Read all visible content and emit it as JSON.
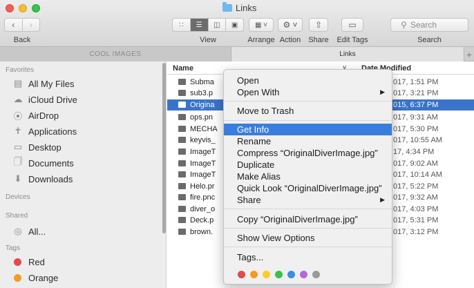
{
  "window": {
    "title": "Links"
  },
  "toolbar": {
    "back_label": "Back",
    "view_label": "View",
    "arrange_label": "Arrange",
    "action_label": "Action",
    "share_label": "Share",
    "edit_tags_label": "Edit Tags",
    "search_label": "Search",
    "search_placeholder": "Search"
  },
  "tabs": [
    {
      "label": "COOL IMAGES",
      "active": false
    },
    {
      "label": "Links",
      "active": true
    }
  ],
  "sidebar": {
    "favorites_header": "Favorites",
    "favorites": [
      {
        "label": "All My Files",
        "icon": "all-files-icon"
      },
      {
        "label": "iCloud Drive",
        "icon": "cloud-icon"
      },
      {
        "label": "AirDrop",
        "icon": "airdrop-icon"
      },
      {
        "label": "Applications",
        "icon": "applications-icon"
      },
      {
        "label": "Desktop",
        "icon": "desktop-icon"
      },
      {
        "label": "Documents",
        "icon": "documents-icon"
      },
      {
        "label": "Downloads",
        "icon": "downloads-icon"
      }
    ],
    "devices_header": "Devices",
    "shared_header": "Shared",
    "shared": [
      {
        "label": "All...",
        "icon": "network-icon"
      }
    ],
    "tags_header": "Tags",
    "tags": [
      {
        "label": "Red",
        "color": "#e5484d"
      },
      {
        "label": "Orange",
        "color": "#f59a23"
      }
    ]
  },
  "file_list": {
    "col_name": "Name",
    "col_date": "Date Modified",
    "rows": [
      {
        "name": "Subma",
        "date": "017, 1:51 PM",
        "selected": false
      },
      {
        "name": "sub3.p",
        "date": "017, 3:21 PM",
        "selected": false
      },
      {
        "name": "Origina",
        "date": "015, 6:37 PM",
        "selected": true
      },
      {
        "name": "ops.pn",
        "date": "017, 9:31 AM",
        "selected": false
      },
      {
        "name": "MECHA",
        "date": "017, 5:30 PM",
        "selected": false
      },
      {
        "name": "keyvis_",
        "date": "017, 10:55 AM",
        "selected": false
      },
      {
        "name": "ImageT",
        "date": "17, 4:34 PM",
        "selected": false
      },
      {
        "name": "ImageT",
        "date": "017, 9:02 AM",
        "selected": false
      },
      {
        "name": "ImageT",
        "date": "017, 10:14 AM",
        "selected": false
      },
      {
        "name": "Helo.pr",
        "date": "017, 5:22 PM",
        "selected": false
      },
      {
        "name": "fire.pnc",
        "date": "017, 9:32 AM",
        "selected": false
      },
      {
        "name": "diver_o",
        "date": "017, 4:03 PM",
        "selected": false
      },
      {
        "name": "Deck.p",
        "date": "017, 5:31 PM",
        "selected": false
      },
      {
        "name": "brown.",
        "date": "017, 3:12 PM",
        "selected": false
      }
    ]
  },
  "context_menu": {
    "items": [
      {
        "label": "Open"
      },
      {
        "label": "Open With",
        "submenu": true
      },
      {
        "label": "Move to Trash"
      },
      {
        "label": "Get Info",
        "highlighted": true
      },
      {
        "label": "Rename"
      },
      {
        "label": "Compress “OriginalDiverImage.jpg”"
      },
      {
        "label": "Duplicate"
      },
      {
        "label": "Make Alias"
      },
      {
        "label": "Quick Look “OriginalDiverImage.jpg”"
      },
      {
        "label": "Share",
        "submenu": true
      },
      {
        "label": "Copy “OriginalDiverImage.jpg”"
      },
      {
        "label": "Show View Options"
      },
      {
        "label": "Tags..."
      }
    ],
    "tag_colors": [
      "#e5484d",
      "#f59a23",
      "#f5cf2c",
      "#3dbf4b",
      "#3b8fe0",
      "#b36ad6",
      "#9a9a9a"
    ]
  }
}
